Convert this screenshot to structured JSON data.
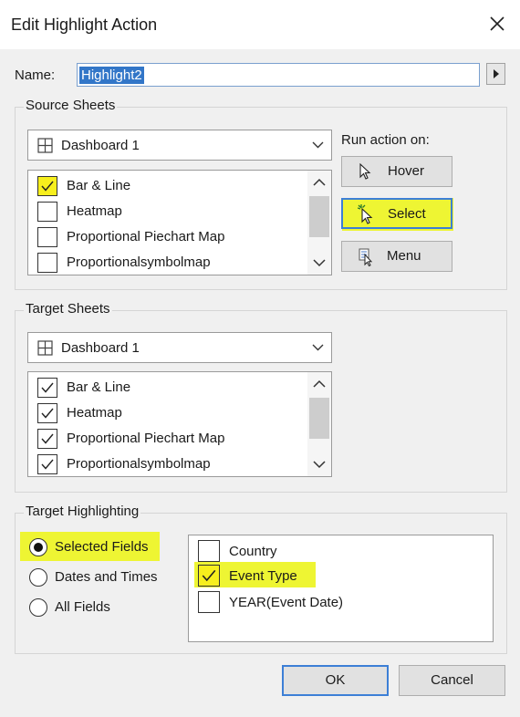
{
  "dialog": {
    "title": "Edit Highlight Action"
  },
  "name_field": {
    "label": "Name:",
    "value": "Highlight2"
  },
  "source": {
    "group_title": "Source Sheets",
    "dashboard": "Dashboard 1",
    "sheets": [
      {
        "label": "Bar & Line",
        "checked": true
      },
      {
        "label": "Heatmap",
        "checked": false
      },
      {
        "label": "Proportional Piechart Map",
        "checked": false
      },
      {
        "label": "Proportionalsymbolmap",
        "checked": false
      }
    ],
    "run_action_label": "Run action on:",
    "buttons": {
      "hover": "Hover",
      "select": "Select",
      "menu": "Menu"
    }
  },
  "target": {
    "group_title": "Target Sheets",
    "dashboard": "Dashboard 1",
    "sheets": [
      {
        "label": "Bar & Line",
        "checked": true
      },
      {
        "label": "Heatmap",
        "checked": true
      },
      {
        "label": "Proportional Piechart Map",
        "checked": true
      },
      {
        "label": "Proportionalsymbolmap",
        "checked": true
      }
    ]
  },
  "highlighting": {
    "group_title": "Target Highlighting",
    "options": [
      "Selected Fields",
      "Dates and Times",
      "All Fields"
    ],
    "selected": "Selected Fields",
    "fields": [
      {
        "label": "Country",
        "checked": false
      },
      {
        "label": "Event Type",
        "checked": true
      },
      {
        "label": "YEAR(Event Date)",
        "checked": false
      }
    ]
  },
  "footer": {
    "ok": "OK",
    "cancel": "Cancel"
  },
  "colors": {
    "highlight": "#eef533",
    "accent": "#3c7fd6",
    "selection": "#3276c8"
  }
}
